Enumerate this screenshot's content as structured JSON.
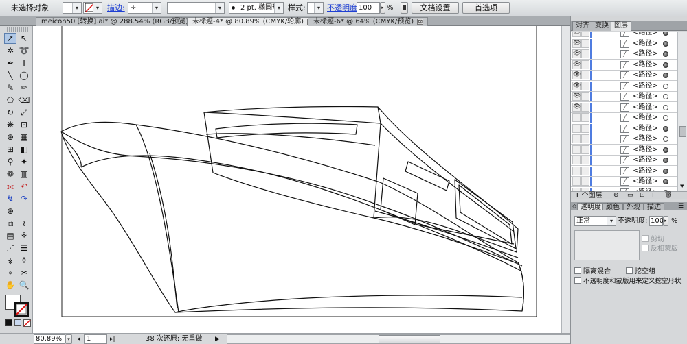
{
  "control_bar": {
    "selection_label": "未选择对象",
    "stroke_label": "描边:",
    "stroke_spinner": "÷",
    "brush_label": "2 pt. 椭圆形",
    "style_label": "样式:",
    "opacity_label": "不透明度:",
    "opacity_value": "100",
    "percent_sign": "%",
    "doc_setup_button": "文档设置",
    "preferences_button": "首选项"
  },
  "tabs": [
    {
      "label": "meicon50 [转换].ai* @ 288.54% (RGB/预览)",
      "close": "⊠"
    },
    {
      "label": "未标题-4* @ 80.89% (CMYK/轮廓)",
      "close": "⊠"
    },
    {
      "label": "未标题-6* @ 64% (CMYK/预览)",
      "close": "⊠"
    }
  ],
  "status_bar": {
    "zoom": "80.89%",
    "artboard": "1",
    "message": "38 次还原: 无重做"
  },
  "panel_tabs_top": [
    "对齐",
    "变换",
    "图层"
  ],
  "layers": {
    "rows": [
      {
        "name": "<路径>",
        "visible": true,
        "target": "filled"
      },
      {
        "name": "<路径>",
        "visible": true,
        "target": "filled"
      },
      {
        "name": "<路径>",
        "visible": true,
        "target": "filled"
      },
      {
        "name": "<路径>",
        "visible": true,
        "target": "filled"
      },
      {
        "name": "<路径>",
        "visible": true,
        "target": "filled"
      },
      {
        "name": "<路径>",
        "visible": true,
        "target": "empty"
      },
      {
        "name": "<路径>",
        "visible": true,
        "target": "empty"
      },
      {
        "name": "<路径>",
        "visible": true,
        "target": "empty"
      },
      {
        "name": "<路径>",
        "visible": false,
        "target": "empty"
      },
      {
        "name": "<路径>",
        "visible": false,
        "target": "filled"
      },
      {
        "name": "<路径>",
        "visible": false,
        "target": "empty"
      },
      {
        "name": "<路径>",
        "visible": false,
        "target": "filled"
      },
      {
        "name": "<路径>",
        "visible": false,
        "target": "filled"
      },
      {
        "name": "<路径>",
        "visible": false,
        "target": "filled"
      },
      {
        "name": "<路径>",
        "visible": false,
        "target": "filled"
      },
      {
        "name": "<路径>",
        "visible": false,
        "target": "empty"
      }
    ],
    "footer": "1 个图层"
  },
  "panel_tabs_bottom": [
    "透明度",
    "颜色",
    "外观",
    "描边"
  ],
  "transparency": {
    "blend_mode": "正常",
    "opacity_label": "不透明度:",
    "opacity_value": "100",
    "percent_sign": "%",
    "clip_label": "剪切",
    "invert_mask_label": "反相蒙版",
    "isolate_blending_label": "隔离混合",
    "knockout_group_label": "挖空组",
    "opacity_mask_label": "不透明度和蒙版用来定义挖空形状"
  },
  "colors": {
    "link": "#1e3fd3",
    "layer_color": "#4f7ce0",
    "tool_selected_bg": "#b0c8e6"
  }
}
